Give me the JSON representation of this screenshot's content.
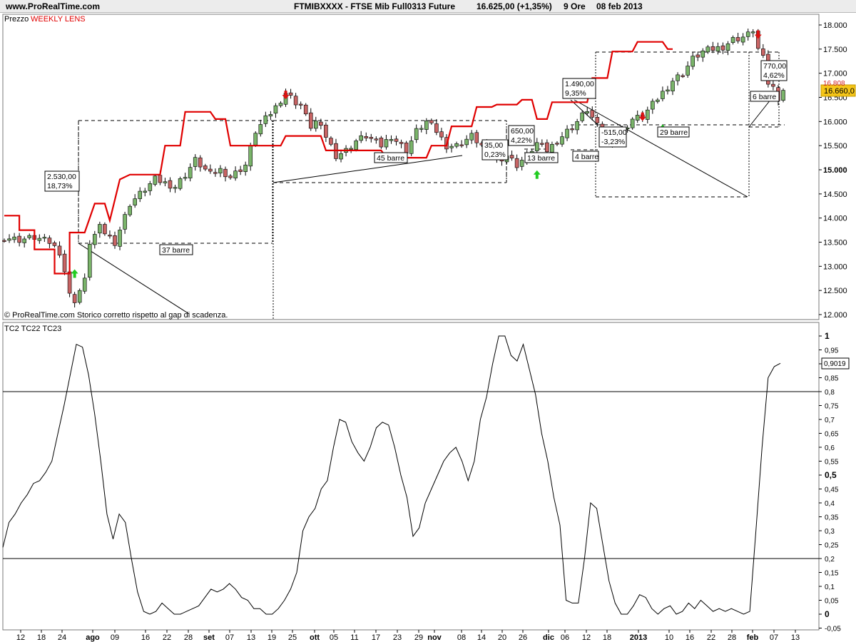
{
  "header": {
    "site": "www.ProRealTime.com",
    "instrument": "FTMIBXXXX - FTSE Mib Full0313 Future",
    "quote": "16.625,00 (+1,35%)",
    "period": "9 Ore",
    "date": "08 feb 2013"
  },
  "price_panel": {
    "label": "Prezzo",
    "indicator_label": "WEEKLY LENS",
    "footer": "© ProRealTime.com  Storico corretto rispetto al gap di scadenza.",
    "last_price_label": "16.660,0",
    "prev_price_label": "16.808"
  },
  "osc_panel": {
    "label": "TC2 TC22 TC23",
    "last_value_label": "0,9019"
  },
  "colors": {
    "up_candle": "#7ab46a",
    "down_candle": "#c86464",
    "weekly_lens": "#e00000",
    "buy_arrow": "#22cc22",
    "sell_arrow": "#dd1111",
    "last_price_bg": "#f5c518"
  },
  "chart_data": [
    {
      "type": "candlestick",
      "title": "FTMIBXXXX - FTSE Mib Full0313 Future",
      "ylim": [
        11900,
        18250
      ],
      "y_ticks": [
        "12.000",
        "12.500",
        "13.000",
        "13.500",
        "14.000",
        "14.500",
        "15.000",
        "15.500",
        "16.000",
        "16.500",
        "17.000",
        "17.500",
        "18.000"
      ],
      "y_ticks_bold": [
        "15.000"
      ],
      "x_ticks": [
        "12",
        "18",
        "24",
        "ago",
        "09",
        "16",
        "22",
        "28",
        "set",
        "07",
        "13",
        "19",
        "25",
        "ott",
        "05",
        "11",
        "17",
        "23",
        "29",
        "nov",
        "08",
        "14",
        "20",
        "26",
        "dic",
        "06",
        "12",
        "18",
        "2013",
        "10",
        "16",
        "22",
        "28",
        "feb",
        "07",
        "13"
      ],
      "x_ticks_bold": [
        "ago",
        "set",
        "ott",
        "nov",
        "dic",
        "2013",
        "feb"
      ],
      "close_anchors": [
        [
          0,
          13600
        ],
        [
          3,
          13550
        ],
        [
          6,
          13600
        ],
        [
          9,
          13500
        ],
        [
          11,
          13300
        ],
        [
          12,
          12900
        ],
        [
          13,
          12400
        ],
        [
          14,
          12300
        ],
        [
          16,
          12700
        ],
        [
          17,
          13500
        ],
        [
          19,
          13800
        ],
        [
          22,
          13500
        ],
        [
          25,
          14300
        ],
        [
          30,
          14800
        ],
        [
          34,
          14650
        ],
        [
          36,
          14900
        ],
        [
          38,
          15200
        ],
        [
          41,
          14900
        ],
        [
          43,
          15000
        ],
        [
          45,
          14850
        ],
        [
          48,
          15100
        ],
        [
          50,
          15800
        ],
        [
          54,
          16300
        ],
        [
          56,
          16600
        ],
        [
          58,
          16400
        ],
        [
          59,
          16350
        ],
        [
          60,
          16100
        ],
        [
          61,
          15900
        ],
        [
          62,
          16000
        ],
        [
          64,
          15700
        ],
        [
          65,
          15500
        ],
        [
          66,
          15300
        ],
        [
          68,
          15400
        ],
        [
          70,
          15600
        ],
        [
          72,
          15700
        ],
        [
          75,
          15500
        ],
        [
          77,
          15700
        ],
        [
          80,
          15400
        ],
        [
          82,
          15800
        ],
        [
          84,
          16000
        ],
        [
          86,
          15800
        ],
        [
          88,
          15500
        ],
        [
          90,
          15500
        ],
        [
          93,
          15700
        ],
        [
          96,
          15400
        ],
        [
          98,
          15200
        ],
        [
          100,
          15300
        ],
        [
          102,
          15100
        ],
        [
          104,
          15300
        ],
        [
          106,
          15550
        ],
        [
          108,
          15400
        ],
        [
          110,
          15600
        ],
        [
          112,
          15800
        ],
        [
          114,
          16000
        ],
        [
          116,
          16250
        ],
        [
          118,
          15900
        ],
        [
          120,
          15500
        ],
        [
          121,
          15600
        ],
        [
          123,
          15800
        ],
        [
          125,
          16050
        ],
        [
          127,
          16100
        ],
        [
          129,
          16350
        ],
        [
          131,
          16600
        ],
        [
          133,
          16850
        ],
        [
          135,
          17000
        ],
        [
          137,
          17300
        ],
        [
          139,
          17450
        ],
        [
          141,
          17500
        ],
        [
          143,
          17550
        ],
        [
          145,
          17700
        ],
        [
          147,
          17750
        ],
        [
          148,
          17800
        ],
        [
          149,
          17900
        ],
        [
          150,
          17500
        ],
        [
          151,
          17300
        ],
        [
          152,
          16800
        ],
        [
          153,
          16700
        ],
        [
          154,
          16500
        ],
        [
          155,
          16660
        ]
      ],
      "weekly_lens": [
        [
          0,
          14050
        ],
        [
          3,
          14050
        ],
        [
          3,
          13750
        ],
        [
          6,
          13750
        ],
        [
          6,
          13350
        ],
        [
          10,
          13350
        ],
        [
          10,
          12850
        ],
        [
          13,
          12850
        ],
        [
          13,
          13700
        ],
        [
          16,
          13700
        ],
        [
          18,
          14300
        ],
        [
          20,
          14300
        ],
        [
          21,
          13950
        ],
        [
          23,
          14800
        ],
        [
          25,
          14900
        ],
        [
          31,
          14900
        ],
        [
          32,
          15500
        ],
        [
          35,
          15500
        ],
        [
          36,
          16200
        ],
        [
          41,
          16200
        ],
        [
          42,
          16050
        ],
        [
          44,
          16050
        ],
        [
          45,
          15500
        ],
        [
          55,
          15500
        ],
        [
          56,
          15700
        ],
        [
          63,
          15700
        ],
        [
          64,
          15400
        ],
        [
          68,
          15400
        ],
        [
          69,
          15400
        ],
        [
          75,
          15400
        ],
        [
          76,
          15250
        ],
        [
          84,
          15250
        ],
        [
          85,
          15500
        ],
        [
          88,
          15500
        ],
        [
          89,
          15900
        ],
        [
          93,
          15900
        ],
        [
          94,
          16300
        ],
        [
          97,
          16300
        ],
        [
          98,
          16350
        ],
        [
          102,
          16350
        ],
        [
          103,
          16450
        ],
        [
          105,
          16450
        ],
        [
          106,
          16050
        ],
        [
          108,
          16050
        ],
        [
          109,
          16400
        ],
        [
          116,
          16400
        ],
        [
          117,
          16900
        ],
        [
          120,
          16900
        ],
        [
          121,
          17450
        ],
        [
          125,
          17450
        ],
        [
          126,
          17650
        ],
        [
          131,
          17650
        ],
        [
          132,
          17500
        ],
        [
          133,
          17500
        ]
      ],
      "signal_arrows": [
        {
          "direction": "up",
          "x_index": 14,
          "price": 12850
        },
        {
          "direction": "down",
          "x_index": 56,
          "price": 16550
        },
        {
          "direction": "up",
          "x_index": 106,
          "price": 14900
        },
        {
          "direction": "down",
          "x_index": 127,
          "price": 16100
        },
        {
          "direction": "up",
          "x_index": 131,
          "price": 15850
        },
        {
          "direction": "down",
          "x_index": 150,
          "price": 17800
        }
      ],
      "annotations": [
        {
          "text": "2.530,00",
          "text2": "18,73%"
        },
        {
          "text": "37 barre"
        },
        {
          "text": "45 barre"
        },
        {
          "text": "35,00",
          "text2": "0,23%"
        },
        {
          "text": "650,00",
          "text2": "4,22%"
        },
        {
          "text": "13 barre"
        },
        {
          "text": "1.490,00",
          "text2": "9,35%"
        },
        {
          "text": "4 barre"
        },
        {
          "text": "-515,00",
          "text2": "-3,23%"
        },
        {
          "text": "29 barre"
        },
        {
          "text": "770,00",
          "text2": "4,62%"
        },
        {
          "text": "6 barre"
        }
      ]
    },
    {
      "type": "line",
      "title": "TC2 TC22 TC23",
      "ylim": [
        -0.05,
        1
      ],
      "y_ticks": [
        "1",
        "0,95",
        "0,9",
        "0,85",
        "0,8",
        "0,75",
        "0,7",
        "0,65",
        "0,6",
        "0,55",
        "0,5",
        "0,45",
        "0,4",
        "0,35",
        "0,3",
        "0,25",
        "0,2",
        "0,15",
        "0,1",
        "0,05",
        "0",
        "-0,05"
      ],
      "y_ticks_bold": [
        "1",
        "0,5",
        "0"
      ],
      "hlines": [
        0.8,
        0.2
      ],
      "series": [
        {
          "values": [
            [
              0,
              0.24
            ],
            [
              1,
              0.33
            ],
            [
              2,
              0.36
            ],
            [
              3,
              0.4
            ],
            [
              4,
              0.43
            ],
            [
              5,
              0.47
            ],
            [
              6,
              0.48
            ],
            [
              7,
              0.51
            ],
            [
              8,
              0.55
            ],
            [
              9,
              0.65
            ],
            [
              10,
              0.75
            ],
            [
              11,
              0.86
            ],
            [
              12,
              0.97
            ],
            [
              13,
              0.96
            ],
            [
              14,
              0.86
            ],
            [
              15,
              0.72
            ],
            [
              16,
              0.55
            ],
            [
              17,
              0.36
            ],
            [
              18,
              0.27
            ],
            [
              19,
              0.36
            ],
            [
              20,
              0.33
            ],
            [
              21,
              0.2
            ],
            [
              22,
              0.08
            ],
            [
              23,
              0.01
            ],
            [
              24,
              0.0
            ],
            [
              25,
              0.01
            ],
            [
              26,
              0.04
            ],
            [
              27,
              0.02
            ],
            [
              28,
              0.0
            ],
            [
              29,
              0.0
            ],
            [
              30,
              0.01
            ],
            [
              31,
              0.02
            ],
            [
              32,
              0.03
            ],
            [
              33,
              0.06
            ],
            [
              34,
              0.09
            ],
            [
              35,
              0.08
            ],
            [
              36,
              0.09
            ],
            [
              37,
              0.11
            ],
            [
              38,
              0.09
            ],
            [
              39,
              0.06
            ],
            [
              40,
              0.05
            ],
            [
              41,
              0.02
            ],
            [
              42,
              0.02
            ],
            [
              43,
              0.0
            ],
            [
              44,
              0.0
            ],
            [
              45,
              0.02
            ],
            [
              46,
              0.05
            ],
            [
              47,
              0.09
            ],
            [
              48,
              0.15
            ],
            [
              49,
              0.3
            ],
            [
              50,
              0.35
            ],
            [
              51,
              0.38
            ],
            [
              52,
              0.45
            ],
            [
              53,
              0.48
            ],
            [
              54,
              0.6
            ],
            [
              55,
              0.7
            ],
            [
              56,
              0.69
            ],
            [
              57,
              0.62
            ],
            [
              58,
              0.58
            ],
            [
              59,
              0.55
            ],
            [
              60,
              0.6
            ],
            [
              61,
              0.67
            ],
            [
              62,
              0.69
            ],
            [
              63,
              0.68
            ],
            [
              64,
              0.6
            ],
            [
              65,
              0.5
            ],
            [
              66,
              0.42
            ],
            [
              67,
              0.28
            ],
            [
              68,
              0.31
            ],
            [
              69,
              0.4
            ],
            [
              70,
              0.45
            ],
            [
              71,
              0.5
            ],
            [
              72,
              0.55
            ],
            [
              73,
              0.58
            ],
            [
              74,
              0.6
            ],
            [
              75,
              0.55
            ],
            [
              76,
              0.48
            ],
            [
              77,
              0.55
            ],
            [
              78,
              0.7
            ],
            [
              79,
              0.78
            ],
            [
              80,
              0.9
            ],
            [
              81,
              1.0
            ],
            [
              82,
              1.0
            ],
            [
              83,
              0.93
            ],
            [
              84,
              0.91
            ],
            [
              85,
              0.97
            ],
            [
              86,
              0.88
            ],
            [
              87,
              0.79
            ],
            [
              88,
              0.65
            ],
            [
              89,
              0.55
            ],
            [
              90,
              0.42
            ],
            [
              91,
              0.32
            ],
            [
              92,
              0.05
            ],
            [
              93,
              0.04
            ],
            [
              94,
              0.04
            ],
            [
              95,
              0.2
            ],
            [
              96,
              0.4
            ],
            [
              97,
              0.38
            ],
            [
              98,
              0.25
            ],
            [
              99,
              0.12
            ],
            [
              100,
              0.04
            ],
            [
              101,
              0.0
            ],
            [
              102,
              0.0
            ],
            [
              103,
              0.03
            ],
            [
              104,
              0.07
            ],
            [
              105,
              0.06
            ],
            [
              106,
              0.02
            ],
            [
              107,
              0.0
            ],
            [
              108,
              0.02
            ],
            [
              109,
              0.03
            ],
            [
              110,
              0.0
            ],
            [
              111,
              0.01
            ],
            [
              112,
              0.04
            ],
            [
              113,
              0.02
            ],
            [
              114,
              0.05
            ],
            [
              115,
              0.03
            ],
            [
              116,
              0.01
            ],
            [
              117,
              0.02
            ],
            [
              118,
              0.01
            ],
            [
              119,
              0.02
            ],
            [
              120,
              0.01
            ],
            [
              121,
              0.0
            ],
            [
              122,
              0.01
            ],
            [
              123,
              0.3
            ],
            [
              124,
              0.6
            ],
            [
              125,
              0.85
            ],
            [
              126,
              0.89
            ],
            [
              127,
              0.9019
            ]
          ]
        }
      ]
    }
  ]
}
